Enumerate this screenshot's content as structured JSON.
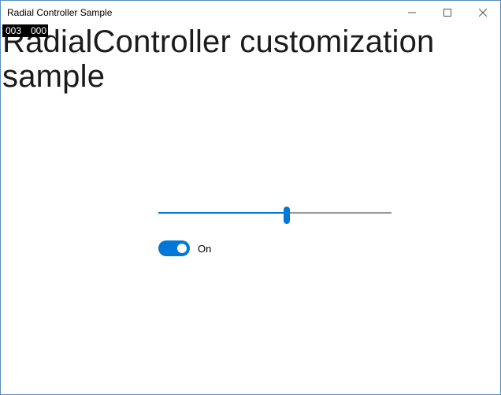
{
  "window": {
    "title": "Radial Controller Sample"
  },
  "counters": {
    "a": "003",
    "b": "000"
  },
  "heading": "RadialController customization sample",
  "slider": {
    "value": 55,
    "min": 0,
    "max": 100
  },
  "toggle": {
    "state": true,
    "label": "On"
  },
  "colors": {
    "accent": "#0078d7"
  }
}
